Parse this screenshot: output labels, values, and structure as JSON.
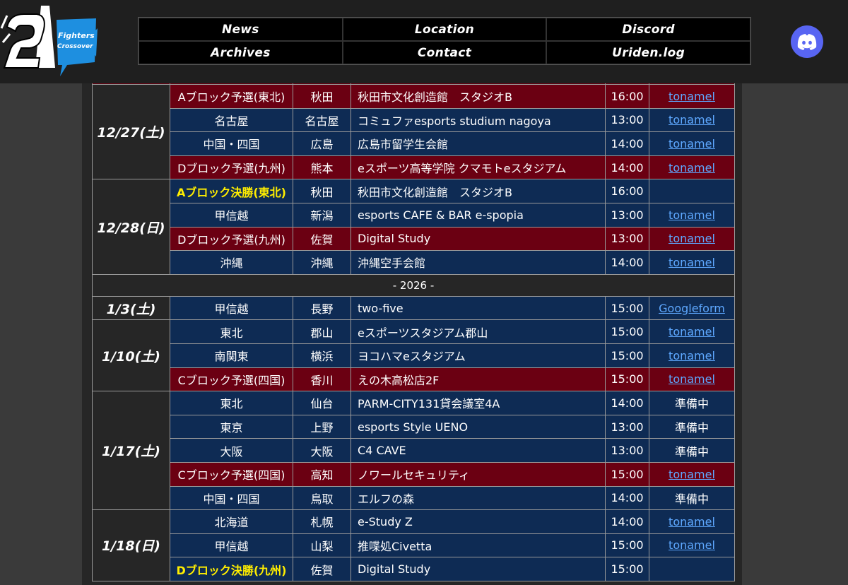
{
  "logo": {
    "text1": "Fighters",
    "text2": "Crossover"
  },
  "nav": [
    {
      "label": "News"
    },
    {
      "label": "Location"
    },
    {
      "label": "Discord"
    },
    {
      "label": "Archives"
    },
    {
      "label": "Contact"
    },
    {
      "label": "Uriden.log"
    }
  ],
  "colors": {
    "blue_row": "#0e2b54",
    "red_row": "#6b0012",
    "highlight": "#ffee00",
    "link": "#5ea8ff",
    "discord": "#5865f2"
  },
  "schedule": [
    {
      "date": "12/27(土)",
      "rows": [
        {
          "color": "red",
          "region": "Aブロック予選(東北)",
          "city": "秋田",
          "venue": "秋田市文化創造館　スタジオB",
          "time": "16:00",
          "entry": "tonamel",
          "entry_type": "link"
        },
        {
          "color": "blue",
          "region": "名古屋",
          "city": "名古屋",
          "venue": "コミュファesports studium nagoya",
          "time": "13:00",
          "entry": "tonamel",
          "entry_type": "link"
        },
        {
          "color": "blue",
          "region": "中国・四国",
          "city": "広島",
          "venue": "広島市留学生会館",
          "time": "14:00",
          "entry": "tonamel",
          "entry_type": "link"
        },
        {
          "color": "red",
          "region": "Dブロック予選(九州)",
          "city": "熊本",
          "venue": "eスポーツ高等学院 クマモトeスタジアム",
          "time": "14:00",
          "entry": "tonamel",
          "entry_type": "link"
        }
      ]
    },
    {
      "date": "12/28(日)",
      "rows": [
        {
          "color": "blue",
          "region": "Aブロック決勝(東北)",
          "highlight": true,
          "city": "秋田",
          "venue": "秋田市文化創造館　スタジオB",
          "time": "16:00",
          "entry": "",
          "entry_type": "none"
        },
        {
          "color": "blue",
          "region": "甲信越",
          "city": "新潟",
          "venue": "esports CAFE & BAR e-spopia",
          "time": "13:00",
          "entry": "tonamel",
          "entry_type": "link"
        },
        {
          "color": "red",
          "region": "Dブロック予選(九州)",
          "city": "佐賀",
          "venue": "Digital Study",
          "time": "13:00",
          "entry": "tonamel",
          "entry_type": "link"
        },
        {
          "color": "blue",
          "region": "沖縄",
          "city": "沖縄",
          "venue": "沖縄空手会館",
          "time": "14:00",
          "entry": "tonamel",
          "entry_type": "link"
        }
      ]
    },
    {
      "year": "- 2026 -"
    },
    {
      "date": "1/3(土)",
      "rows": [
        {
          "color": "blue",
          "region": "甲信越",
          "city": "長野",
          "venue": "two-five",
          "time": "15:00",
          "entry": "Googleform",
          "entry_type": "link"
        }
      ]
    },
    {
      "date": "1/10(土)",
      "rows": [
        {
          "color": "blue",
          "region": "東北",
          "city": "郡山",
          "venue": "eスポーツスタジアム郡山",
          "time": "15:00",
          "entry": "tonamel",
          "entry_type": "link"
        },
        {
          "color": "blue",
          "region": "南関東",
          "city": "横浜",
          "venue": "ヨコハマeスタジアム",
          "time": "15:00",
          "entry": "tonamel",
          "entry_type": "link"
        },
        {
          "color": "red",
          "region": "Cブロック予選(四国)",
          "city": "香川",
          "venue": "えの木高松店2F",
          "time": "15:00",
          "entry": "tonamel",
          "entry_type": "link"
        }
      ]
    },
    {
      "date": "1/17(土)",
      "rows": [
        {
          "color": "blue",
          "region": "東北",
          "city": "仙台",
          "venue": "PARM-CITY131貸会議室4A",
          "time": "14:00",
          "entry": "準備中",
          "entry_type": "text"
        },
        {
          "color": "blue",
          "region": "東京",
          "city": "上野",
          "venue": "esports Style UENO",
          "time": "13:00",
          "entry": "準備中",
          "entry_type": "text"
        },
        {
          "color": "blue",
          "region": "大阪",
          "city": "大阪",
          "venue": "C4 CAVE",
          "time": "13:00",
          "entry": "準備中",
          "entry_type": "text"
        },
        {
          "color": "red",
          "region": "Cブロック予選(四国)",
          "city": "高知",
          "venue": "ノワールセキュリティ",
          "time": "15:00",
          "entry": "tonamel",
          "entry_type": "link"
        },
        {
          "color": "blue",
          "region": "中国・四国",
          "city": "鳥取",
          "venue": "エルフの森",
          "time": "14:00",
          "entry": "準備中",
          "entry_type": "text"
        }
      ]
    },
    {
      "date": "1/18(日)",
      "rows": [
        {
          "color": "blue",
          "region": "北海道",
          "city": "札幌",
          "venue": "e-Study Z",
          "time": "14:00",
          "entry": "tonamel",
          "entry_type": "link"
        },
        {
          "color": "blue",
          "region": "甲信越",
          "city": "山梨",
          "venue": "推喋処Civetta",
          "time": "15:00",
          "entry": "tonamel",
          "entry_type": "link"
        },
        {
          "color": "blue",
          "region": "Dブロック決勝(九州)",
          "highlight": true,
          "city": "佐賀",
          "venue": "Digital Study",
          "time": "15:00",
          "entry": "",
          "entry_type": "none"
        }
      ]
    }
  ]
}
